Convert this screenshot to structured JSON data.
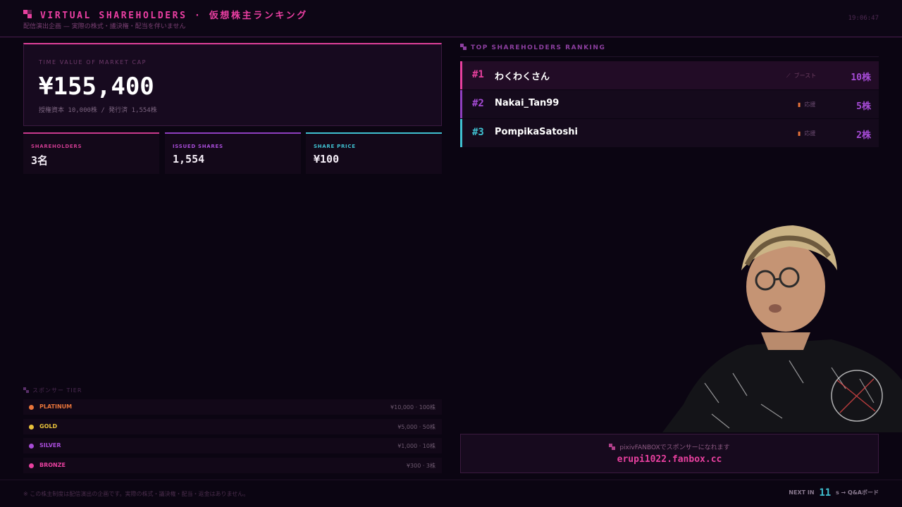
{
  "header": {
    "title": "VIRTUAL SHAREHOLDERS · 仮想株主ランキング",
    "subtitle": "配信演出企画 — 実際の株式・議決権・配当を伴いません",
    "clock": "19:06:47"
  },
  "market_cap": {
    "label": "TIME VALUE OF MARKET CAP",
    "value": "¥155,400",
    "note": "授権資本 10,000株 / 発行済 1,554株"
  },
  "stats": [
    {
      "label": "SHAREHOLDERS",
      "value": "3名",
      "color": "#c93a8e"
    },
    {
      "label": "ISSUED SHARES",
      "value": "1,554",
      "color": "#8f3fc0"
    },
    {
      "label": "SHARE PRICE",
      "value": "¥100",
      "color": "#3fc0d0"
    }
  ],
  "ranking": {
    "title": "TOP SHAREHOLDERS RANKING",
    "rows": [
      {
        "rank": "#1",
        "name": "わくわくさん",
        "tag_icon": "rocket-icon",
        "tag": "ブースト",
        "shares": "10株"
      },
      {
        "rank": "#2",
        "name": "Nakai_Tan99",
        "tag_icon": "bars-icon",
        "tag": "応援",
        "shares": "5株"
      },
      {
        "rank": "#3",
        "name": "PompikaSatoshi",
        "tag_icon": "bars-icon",
        "tag": "応援",
        "shares": "2株"
      }
    ]
  },
  "tiers": {
    "title": "スポンサー TIER",
    "items": [
      {
        "name": "PLATINUM",
        "price": "¥10,000 · 100株",
        "color": "#e8743a"
      },
      {
        "name": "GOLD",
        "price": "¥5,000 · 50株",
        "color": "#e8c13a"
      },
      {
        "name": "SILVER",
        "price": "¥1,000 · 10株",
        "color": "#a64bd6"
      },
      {
        "name": "BRONZE",
        "price": "¥300 · 3株",
        "color": "#e8409f"
      }
    ]
  },
  "sponsor": {
    "line1": "pixivFANBOXでスポンサーになれます",
    "url": "erupi1022.fanbox.cc"
  },
  "footer": {
    "note": "※ この株主制度は配信演出の企画です。実際の株式・議決権・配当・返金はありません。",
    "next_prefix": "NEXT IN",
    "next_seconds": "11",
    "next_suffix": "s → Q&Aボード"
  }
}
